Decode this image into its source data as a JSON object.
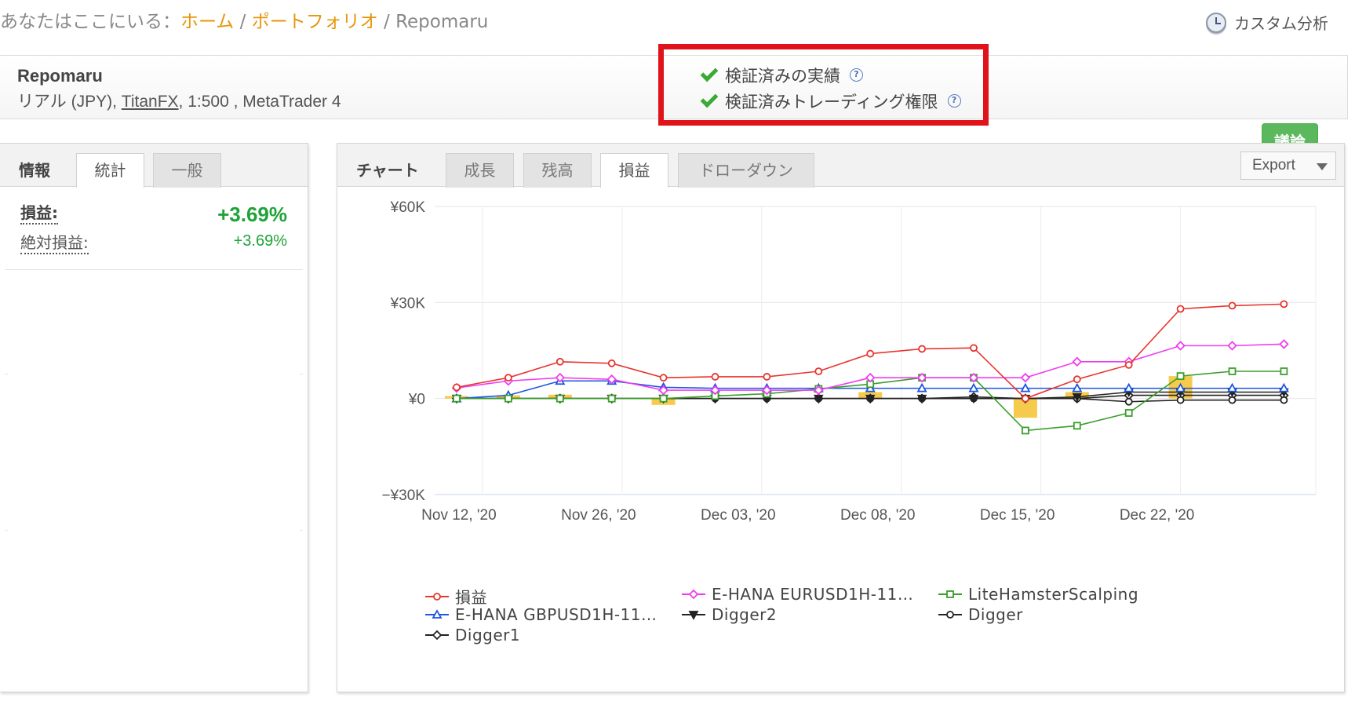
{
  "breadcrumb": {
    "prefix": "あなたはここにいる：",
    "home": "ホーム",
    "portfolio": "ポートフォリオ",
    "current": "Repomaru",
    "separator": "/"
  },
  "custom_analysis": "カスタム分析",
  "account": {
    "name": "Repomaru",
    "type": "リアル (JPY), ",
    "broker": "TitanFX",
    "details_rest": ", 1:500 , MetaTrader 4",
    "verified_track_record": "検証済みの実績",
    "verified_trading_privileges": "検証済みトレーディング権限",
    "help_glyph": "?",
    "discuss_button": "議論"
  },
  "info_panel": {
    "title": "情報",
    "tabs": [
      "統計",
      "一般"
    ],
    "active_tab": "統計",
    "stats": [
      {
        "label": "損益:",
        "value": "+3.69%"
      },
      {
        "label": "絶対損益:",
        "value": "+3.69%"
      }
    ]
  },
  "chart_panel": {
    "title": "チャート",
    "tabs": [
      "成長",
      "残高",
      "損益",
      "ドローダウン"
    ],
    "active_tab": "損益",
    "export": "Export"
  },
  "chart_data": {
    "type": "line",
    "y_ticks": [
      "¥60K",
      "¥30K",
      "¥0",
      "−¥30K"
    ],
    "x_ticks": [
      "Nov 12, '20",
      "Nov 26, '20",
      "Dec 03, '20",
      "Dec 08, '20",
      "Dec 15, '20",
      "Dec 22, '20"
    ],
    "ylim": [
      -30000,
      60000
    ],
    "grid": true,
    "legend_placement": "bottom",
    "bars": {
      "color": "#f5c53a",
      "values": [
        800,
        1000,
        1200,
        0,
        -2000,
        0,
        0,
        0,
        2000,
        0,
        0,
        -6000,
        2000,
        0,
        7000,
        0,
        0
      ]
    },
    "series": [
      {
        "name": "損益",
        "color": "#e8352e",
        "marker": "circle",
        "values": [
          3500,
          6500,
          11500,
          11000,
          6500,
          6800,
          6800,
          8500,
          14000,
          15500,
          15800,
          0,
          6000,
          10500,
          28000,
          29000,
          29500
        ]
      },
      {
        "name": "E-HANA EURUSD1H-11…",
        "color": "#f03cf0",
        "marker": "diamond",
        "values": [
          3300,
          5500,
          6500,
          6000,
          2600,
          2600,
          2600,
          2600,
          6500,
          6500,
          6500,
          6500,
          11500,
          11500,
          16500,
          16500,
          17000
        ]
      },
      {
        "name": "LiteHamsterScalping",
        "color": "#3a9f2a",
        "marker": "square",
        "values": [
          0,
          0,
          0,
          0,
          0,
          800,
          1500,
          3000,
          4500,
          6500,
          6500,
          -10000,
          -8500,
          -4500,
          7000,
          8500,
          8500
        ]
      },
      {
        "name": "E-HANA GBPUSD1H-11…",
        "color": "#1b56e0",
        "marker": "triangle",
        "values": [
          0,
          1000,
          5500,
          5500,
          3500,
          3200,
          3200,
          3200,
          3200,
          3200,
          3200,
          3200,
          3200,
          3200,
          3200,
          3200,
          3200
        ]
      },
      {
        "name": "Digger2",
        "color": "#222222",
        "marker": "triangle-down",
        "values": [
          0,
          0,
          0,
          0,
          0,
          0,
          0,
          0,
          0,
          0,
          0,
          0,
          500,
          2000,
          2000,
          2000,
          2000
        ]
      },
      {
        "name": "Digger",
        "color": "#222222",
        "marker": "circle",
        "values": [
          0,
          0,
          0,
          0,
          0,
          0,
          0,
          0,
          0,
          0,
          0,
          0,
          0,
          -1000,
          -500,
          -500,
          -500
        ]
      },
      {
        "name": "Digger1",
        "color": "#222222",
        "marker": "diamond",
        "values": [
          0,
          0,
          0,
          0,
          0,
          0,
          0,
          0,
          0,
          0,
          500,
          0,
          0,
          1000,
          1000,
          1000,
          1000
        ]
      }
    ]
  }
}
